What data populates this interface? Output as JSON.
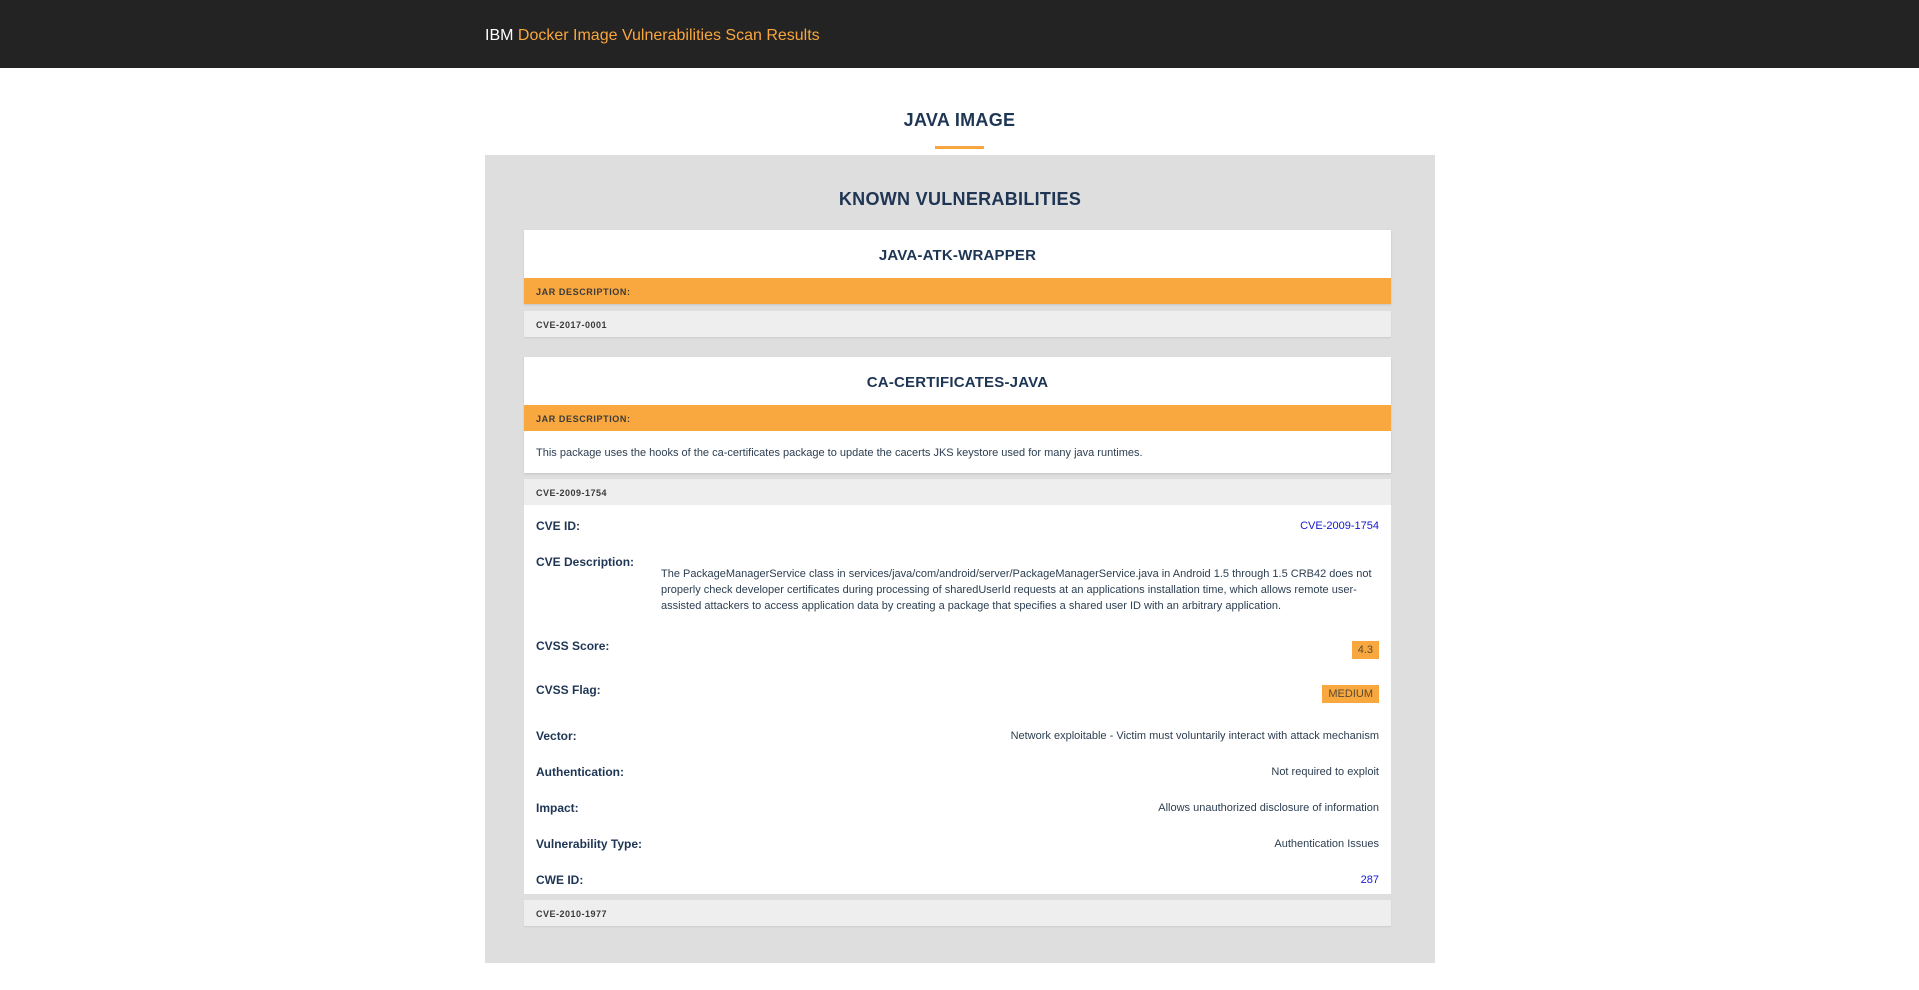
{
  "header": {
    "brand": "IBM",
    "title": "Docker Image Vulnerabilities Scan Results"
  },
  "page": {
    "title": "JAVA IMAGE"
  },
  "panel": {
    "title": "KNOWN VULNERABILITIES"
  },
  "packages": [
    {
      "name": "JAVA-ATK-WRAPPER",
      "jar_label": "JAR DESCRIPTION:",
      "jar_description": "",
      "cves": [
        "CVE-2017-0001"
      ]
    },
    {
      "name": "CA-CERTIFICATES-JAVA",
      "jar_label": "JAR DESCRIPTION:",
      "jar_description": "This package uses the hooks of the ca-certificates package to update the cacerts JKS keystore used for many java runtimes.",
      "cves": [
        "CVE-2009-1754",
        "CVE-2010-1977"
      ]
    }
  ],
  "cve_detail": {
    "cve_id_label": "CVE ID:",
    "cve_id": "CVE-2009-1754",
    "description_label": "CVE Description:",
    "description": "The PackageManagerService class in services/java/com/android/server/PackageManagerService.java in Android 1.5 through 1.5 CRB42 does not properly check developer certificates during processing of sharedUserId requests at an applications installation time, which allows remote user-assisted attackers to access application data by creating a package that specifies a shared user ID with an arbitrary application.",
    "cvss_score_label": "CVSS Score:",
    "cvss_score": "4.3",
    "cvss_flag_label": "CVSS Flag:",
    "cvss_flag": "MEDIUM",
    "vector_label": "Vector:",
    "vector": "Network exploitable - Victim must voluntarily interact with attack mechanism",
    "authentication_label": "Authentication:",
    "authentication": "Not required to exploit",
    "impact_label": "Impact:",
    "impact": "Allows unauthorized disclosure of information",
    "vuln_type_label": "Vulnerability Type:",
    "vuln_type": "Authentication Issues",
    "cwe_id_label": "CWE ID:",
    "cwe_id": "287"
  },
  "colors": {
    "accent": "#f9a63e",
    "navy": "#1e3553",
    "topbar": "#232323",
    "panel": "#dedede",
    "link": "#1515d6"
  }
}
